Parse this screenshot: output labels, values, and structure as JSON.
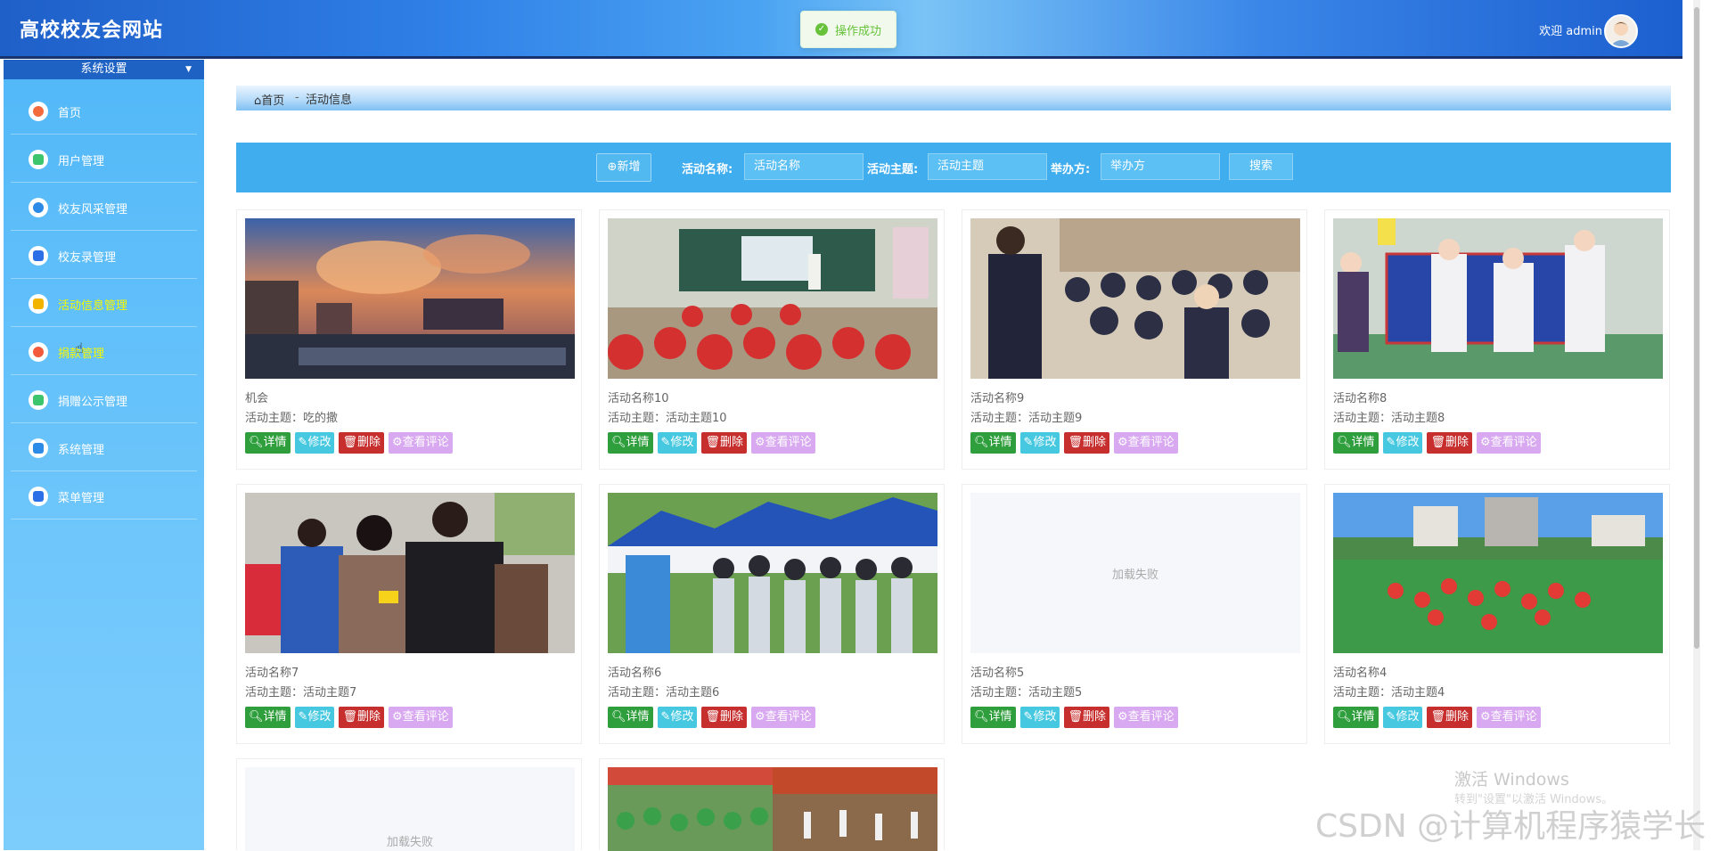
{
  "header": {
    "title": "高校校友会网站",
    "welcome": "欢迎 admin"
  },
  "toast": {
    "message": "操作成功"
  },
  "sidebar": {
    "section": "系统设置",
    "items": [
      {
        "label": "首页",
        "color": "#f36a3c"
      },
      {
        "label": "用户管理",
        "color": "#3dc56e"
      },
      {
        "label": "校友风采管理",
        "color": "#2c8be6"
      },
      {
        "label": "校友录管理",
        "color": "#2c6fe6"
      },
      {
        "label": "活动信息管理",
        "color": "#f3b400"
      },
      {
        "label": "捐款管理",
        "color": "#f35a3c"
      },
      {
        "label": "捐赠公示管理",
        "color": "#3dc56e"
      },
      {
        "label": "系统管理",
        "color": "#2c8be6"
      },
      {
        "label": "菜单管理",
        "color": "#2c6fe6"
      }
    ]
  },
  "breadcrumb": {
    "home": "首页",
    "separator": "-",
    "current": "活动信息"
  },
  "search": {
    "add_label": "新增",
    "name_label": "活动名称:",
    "name_placeholder": "活动名称",
    "theme_label": "活动主题:",
    "theme_placeholder": "活动主题",
    "host_label": "举办方:",
    "host_placeholder": "举办方",
    "search_label": "搜索"
  },
  "buttons": {
    "detail": "详情",
    "edit": "修改",
    "delete": "删除",
    "comment": "查看评论"
  },
  "cards": [
    {
      "name": "机会",
      "theme": "活动主题：吃的撒",
      "image": "sunset-city"
    },
    {
      "name": "活动名称10",
      "theme": "活动主题：活动主题10",
      "image": "classroom"
    },
    {
      "name": "活动名称9",
      "theme": "活动主题：活动主题9",
      "image": "auditorium"
    },
    {
      "name": "活动名称8",
      "theme": "活动主题：活动主题8",
      "image": "kids-sports"
    },
    {
      "name": "活动名称7",
      "theme": "活动主题：活动主题7",
      "image": "street-people"
    },
    {
      "name": "活动名称6",
      "theme": "活动主题：活动主题6",
      "image": "tents"
    },
    {
      "name": "活动名称5",
      "theme": "活动主题：活动主题5",
      "image": "failed",
      "image_text": "加载失败"
    },
    {
      "name": "活动名称4",
      "theme": "活动主题：活动主题4",
      "image": "field-dance"
    },
    {
      "name": "",
      "theme": "",
      "image": "failed",
      "image_text": "加载失败"
    },
    {
      "name": "",
      "theme": "",
      "image": "sports-collage"
    }
  ],
  "watermarks": {
    "activate_title": "激活 Windows",
    "activate_sub": "转到\"设置\"以激活 Windows。",
    "csdn": "CSDN @计算机程序猿学长"
  }
}
